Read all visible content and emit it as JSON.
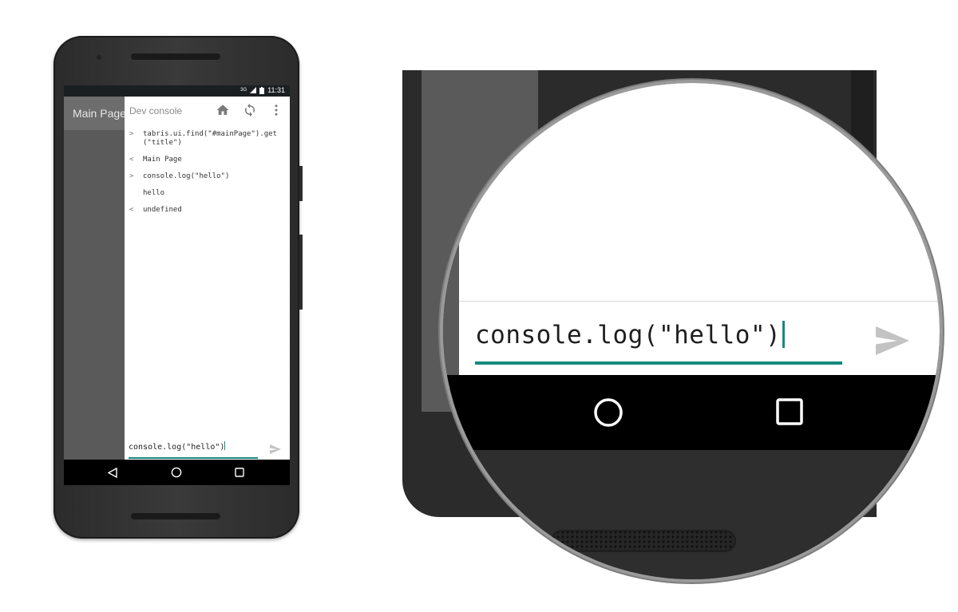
{
  "status_bar": {
    "network": "3G",
    "time": "11:31"
  },
  "app_bar": {
    "title": "Main Page"
  },
  "dev_console": {
    "title": "Dev console",
    "icons": [
      "home-icon",
      "reload-icon",
      "more-vert-icon"
    ],
    "log": [
      {
        "kind": "input",
        "marker": ">",
        "text": "tabris.ui.find(\"#mainPage\").get(\"title\")"
      },
      {
        "kind": "output",
        "marker": "<",
        "text": "Main Page"
      },
      {
        "kind": "input",
        "marker": ">",
        "text": "console.log(\"hello\")"
      },
      {
        "kind": "log",
        "marker": "",
        "text": "hello"
      },
      {
        "kind": "output",
        "marker": "<",
        "text": "undefined"
      }
    ],
    "input_value": "console.log(\"hello\")",
    "send_icon": "send-icon"
  },
  "nav_bar": {
    "icons": [
      "back-icon",
      "home-circle-icon",
      "recents-icon"
    ]
  },
  "magnifier": {
    "input_value": "console.log(\"hello\")",
    "send_icon": "send-icon",
    "nav_icons": [
      "home-circle-icon",
      "recents-icon"
    ]
  },
  "colors": {
    "accent": "#16897d",
    "app_bar": "#6d6d6d",
    "status_bar": "#1a1f21",
    "nav_bar": "#000000"
  }
}
